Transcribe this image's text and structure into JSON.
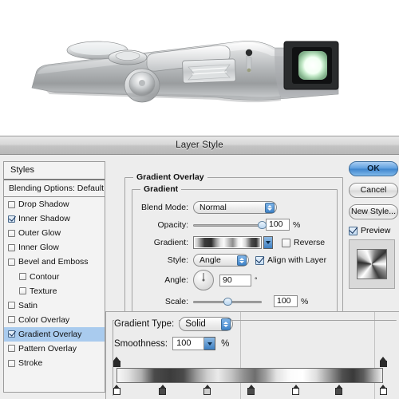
{
  "photo": {
    "alt_name": "silver-compact-camera-top-view",
    "description": "Top view of a silver compact camera with mode dial, shutter button, flash window and lens"
  },
  "dialog": {
    "title": "Layer Style"
  },
  "styles_panel": {
    "header": "Styles",
    "blending_options": "Blending Options: Default",
    "items": [
      {
        "label": "Drop Shadow",
        "checked": false,
        "indent": false,
        "selected": false
      },
      {
        "label": "Inner Shadow",
        "checked": true,
        "indent": false,
        "selected": false
      },
      {
        "label": "Outer Glow",
        "checked": false,
        "indent": false,
        "selected": false
      },
      {
        "label": "Inner Glow",
        "checked": false,
        "indent": false,
        "selected": false
      },
      {
        "label": "Bevel and Emboss",
        "checked": false,
        "indent": false,
        "selected": false
      },
      {
        "label": "Contour",
        "checked": false,
        "indent": true,
        "selected": false
      },
      {
        "label": "Texture",
        "checked": false,
        "indent": true,
        "selected": false
      },
      {
        "label": "Satin",
        "checked": false,
        "indent": false,
        "selected": false
      },
      {
        "label": "Color Overlay",
        "checked": false,
        "indent": false,
        "selected": false
      },
      {
        "label": "Gradient Overlay",
        "checked": true,
        "indent": false,
        "selected": true
      },
      {
        "label": "Pattern Overlay",
        "checked": false,
        "indent": false,
        "selected": false
      },
      {
        "label": "Stroke",
        "checked": false,
        "indent": false,
        "selected": false
      }
    ]
  },
  "buttons": {
    "ok": "OK",
    "cancel": "Cancel",
    "new_style": "New Style...",
    "preview_label": "Preview",
    "preview_checked": true
  },
  "gradient_overlay": {
    "group_title": "Gradient Overlay",
    "subgroup_title": "Gradient",
    "blend_mode": {
      "label": "Blend Mode:",
      "value": "Normal"
    },
    "opacity": {
      "label": "Opacity:",
      "value": "100",
      "unit": "%",
      "percent": 100
    },
    "gradient": {
      "label": "Gradient:"
    },
    "reverse": {
      "label": "Reverse",
      "checked": false
    },
    "style": {
      "label": "Style:",
      "value": "Angle"
    },
    "align": {
      "label": "Align with Layer",
      "checked": true
    },
    "angle": {
      "label": "Angle:",
      "value": "90",
      "unit": "°"
    },
    "scale": {
      "label": "Scale:",
      "value": "100",
      "unit": "%",
      "percent": 50
    }
  },
  "gradient_editor": {
    "gradient_type": {
      "label": "Gradient Type:",
      "value": "Solid"
    },
    "smoothness": {
      "label": "Smoothness:",
      "value": "100",
      "unit": "%"
    },
    "opacity_stops": [
      {
        "position": 0,
        "opacity": 100
      },
      {
        "position": 100,
        "opacity": 100
      }
    ],
    "color_stops": [
      {
        "position": 0,
        "color": "#ffffff",
        "kind": "light"
      },
      {
        "position": 17.3,
        "color": "#3d3d3d",
        "kind": "dark"
      },
      {
        "position": 34.0,
        "color": "#cdcdcd",
        "kind": "mid"
      },
      {
        "position": 50.5,
        "color": "#4a4a4a",
        "kind": "dark"
      },
      {
        "position": 67.3,
        "color": "#ffffff",
        "kind": "light"
      },
      {
        "position": 83.5,
        "color": "#4a4a4a",
        "kind": "dark"
      },
      {
        "position": 100,
        "color": "#ffffff",
        "kind": "light"
      }
    ]
  },
  "colors": {
    "accent_blue": "#3f84c9",
    "selection_blue": "#a9cbee",
    "dialog_bg": "#ededed",
    "panel_bg": "#f3f3f3"
  }
}
